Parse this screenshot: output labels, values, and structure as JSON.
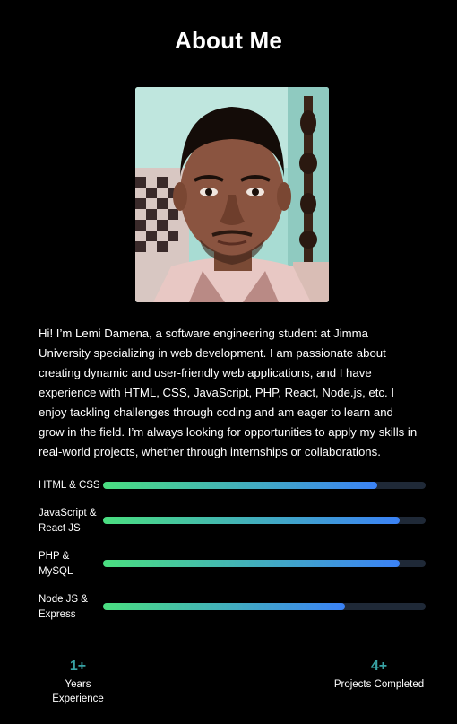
{
  "section": {
    "title": "About Me"
  },
  "profile": {
    "photo_icon": "profile-photo",
    "bio": "Hi! I’m Lemi Damena, a software engineering student at Jimma University specializing in web development. I am passionate about creating dynamic and user-friendly web applications, and I have experience with HTML, CSS, JavaScript, PHP, React, Node.js, etc. I enjoy tackling challenges through coding and am eager to learn and grow in the field. I’m always looking for opportunities to apply my skills in real-world projects, whether through internships or collaborations."
  },
  "skills": [
    {
      "label": "HTML & CSS",
      "percent": 85
    },
    {
      "label": "JavaScript & React JS",
      "percent": 92
    },
    {
      "label": "PHP & MySQL",
      "percent": 92
    },
    {
      "label": "Node JS & Express",
      "percent": 75
    }
  ],
  "stats": [
    {
      "value": "1+",
      "label": "Years Experience"
    },
    {
      "value": "4+",
      "label": "Projects Completed"
    }
  ],
  "colors": {
    "background": "#000000",
    "bar_start": "#4ade80",
    "bar_end": "#3b82f6",
    "track": "#1f2937",
    "stat_accent": "#38a3a5"
  }
}
